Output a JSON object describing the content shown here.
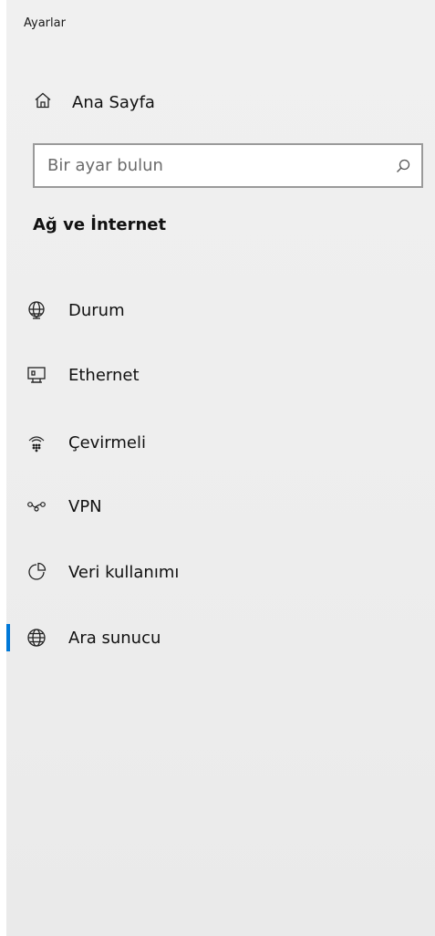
{
  "app": {
    "title": "Ayarlar"
  },
  "home": {
    "label": "Ana Sayfa",
    "icon": "home-icon"
  },
  "search": {
    "placeholder": "Bir ayar bulun",
    "value": ""
  },
  "section": {
    "title": "Ağ ve İnternet"
  },
  "nav": {
    "items": [
      {
        "label": "Durum",
        "icon": "globe-status-icon"
      },
      {
        "label": "Ethernet",
        "icon": "ethernet-monitor-icon"
      },
      {
        "label": "Çevirmeli",
        "icon": "dialup-icon"
      },
      {
        "label": "VPN",
        "icon": "vpn-icon"
      },
      {
        "label": "Veri kullanımı",
        "icon": "data-usage-icon"
      },
      {
        "label": "Ara sunucu",
        "icon": "globe-icon",
        "active": true
      }
    ]
  },
  "colors": {
    "accent": "#0078d7",
    "pane_background": "#efefef"
  }
}
